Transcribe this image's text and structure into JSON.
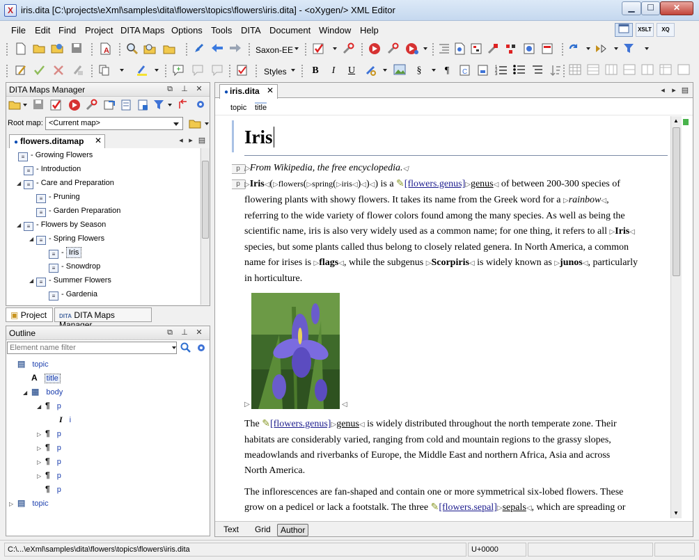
{
  "window": {
    "title": "iris.dita [C:\\projects\\eXml\\samples\\dita\\flowers\\topics\\flowers\\iris.dita] - <oXygen/> XML Editor",
    "minimize": "▁",
    "maximize": "☐",
    "close": "✕"
  },
  "menu": [
    "File",
    "Edit",
    "Find",
    "Project",
    "DITA Maps",
    "Options",
    "Tools",
    "DITA",
    "Document",
    "Window",
    "Help"
  ],
  "perspectives": [
    "XSLT",
    "XQ"
  ],
  "toolbar": {
    "transform_scenario": "Saxon-EE",
    "styles": "Styles"
  },
  "dita_maps_manager": {
    "title": "DITA Maps Manager",
    "root_map_label": "Root map:",
    "root_map_value": "<Current map>",
    "map_tab": "flowers.ditamap",
    "tree": [
      {
        "label": "Growing Flowers",
        "level": 0,
        "toggle": ""
      },
      {
        "label": "Introduction",
        "level": 1,
        "toggle": ""
      },
      {
        "label": "Care and Preparation",
        "level": 1,
        "toggle": "◢"
      },
      {
        "label": "Pruning",
        "level": 2,
        "toggle": ""
      },
      {
        "label": "Garden Preparation",
        "level": 2,
        "toggle": ""
      },
      {
        "label": "Flowers by Season",
        "level": 1,
        "toggle": "◢"
      },
      {
        "label": "Spring Flowers",
        "level": 2,
        "toggle": "◢"
      },
      {
        "label": "Iris",
        "level": 3,
        "toggle": "",
        "selected": true
      },
      {
        "label": "Snowdrop",
        "level": 3,
        "toggle": ""
      },
      {
        "label": "Summer Flowers",
        "level": 2,
        "toggle": "◢"
      },
      {
        "label": "Gardenia",
        "level": 3,
        "toggle": ""
      }
    ]
  },
  "side_tabs": {
    "project": "Project",
    "dita_maps": "DITA Maps Manager"
  },
  "outline": {
    "title": "Outline",
    "filter_placeholder": "Element name filter",
    "rows": [
      {
        "label": "topic",
        "icon": "▤",
        "indent": 0,
        "toggle": ""
      },
      {
        "label": "title",
        "icon": "A",
        "indent": 1,
        "toggle": "",
        "selected": true
      },
      {
        "label": "body",
        "icon": "▦",
        "indent": 1,
        "toggle": "◢"
      },
      {
        "label": "p",
        "icon": "¶",
        "indent": 2,
        "toggle": "◢"
      },
      {
        "label": "i",
        "icon": "I",
        "indent": 3,
        "toggle": ""
      },
      {
        "label": "p",
        "icon": "¶",
        "indent": 2,
        "toggle": "▷"
      },
      {
        "label": "p",
        "icon": "¶",
        "indent": 2,
        "toggle": "▷"
      },
      {
        "label": "p",
        "icon": "¶",
        "indent": 2,
        "toggle": "▷"
      },
      {
        "label": "p",
        "icon": "¶",
        "indent": 2,
        "toggle": "▷"
      },
      {
        "label": "p",
        "icon": "¶",
        "indent": 2,
        "toggle": ""
      },
      {
        "label": "topic",
        "icon": "▤",
        "indent": 0,
        "toggle": "▷"
      }
    ]
  },
  "editor": {
    "tab": "iris.dita",
    "breadcrumbs": [
      "topic",
      "title"
    ],
    "doc_title": "Iris",
    "para1": "From Wikipedia, the free encyclopedia.",
    "para2": {
      "w_iris": "Iris",
      "w_flowers": "flowers",
      "w_spring": "spring",
      "w_iris_small": "iris",
      "w_is_a": ") is a",
      "link_genus": "[flowers.genus]",
      "w_genus": "genus",
      "rest1": "of between 200-300 species of",
      "line2a": "flowering plants with showy flowers. It takes its name from the Greek word for a",
      "w_rainbow": "rainbow",
      "line3": "referring to the wide variety of flower colors found among the many species. As well as being the",
      "line4a": "scientific name, iris is also very widely used as a common name; for one thing, it refers to all",
      "w_iris2": "Iris",
      "line5": "species, but some plants called thus belong to closely related genera. In North America, a common",
      "line6a": "name for irises is",
      "w_flags": "flags",
      "line6b": ", while the subgenus",
      "w_scorpiris": "Scorpiris",
      "line6c": "is widely known as",
      "w_junos": "junos",
      "line6d": ", particularly",
      "line7": "in horticulture."
    },
    "para3": {
      "w_the": "The",
      "link_genus": "[flowers.genus]",
      "w_genus": "genus",
      "line1b": "is widely distributed throughout the north temperate zone. Their",
      "line2": "habitats are considerably varied, ranging from cold and mountain regions to the grassy slopes,",
      "line3": "meadowlands and riverbanks of Europe, the Middle East and northern Africa, Asia and across",
      "line4": "North America."
    },
    "para4": {
      "line1": "The inflorescences are fan-shaped and contain one or more symmetrical six-lobed flowers. These",
      "line2a": "grow on a pedicel or lack a footstalk. The three",
      "link_sepal": "[flowers.sepal]",
      "w_sepals": "sepals",
      "line2b": ", which are spreading or"
    },
    "modes": [
      "Text",
      "Grid",
      "Author"
    ],
    "active_mode": "Author"
  },
  "statusbar": {
    "path": "C:\\...\\eXml\\samples\\dita\\flowers\\topics\\flowers\\iris.dita",
    "unicode": "U+0000"
  },
  "colors": {
    "link": "#1a1a8c",
    "outline_text": "#1c3fae",
    "title_accent": "#a9c1e5",
    "marker": "#48b34b"
  }
}
